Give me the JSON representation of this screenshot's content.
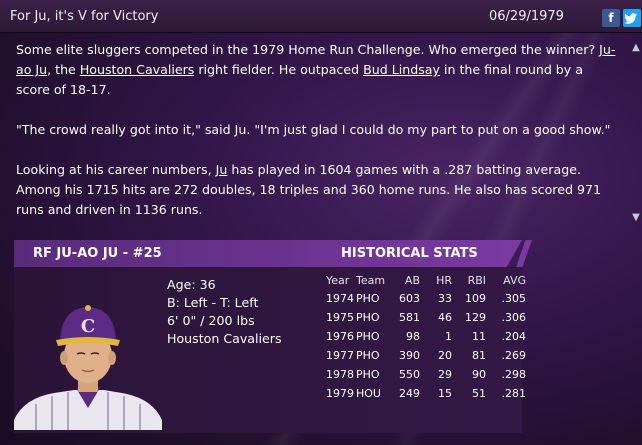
{
  "header": {
    "title": "For Ju, it's V for Victory",
    "date": "06/29/1979",
    "share_facebook": "f",
    "share_twitter": "t"
  },
  "article": {
    "p1_a": "Some elite sluggers competed in the 1979 Home Run Challenge. Who emerged the winner? ",
    "p1_link_player": "Ju-ao Ju",
    "p1_b": ", the ",
    "p1_link_team": "Houston Cavaliers",
    "p1_c": " right fielder. He outpaced ",
    "p1_link_opponent": "Bud Lindsay",
    "p1_d": " in the final round by a score of 18-17.",
    "p2": "\"The crowd really got into it,\" said Ju. \"I'm just glad I could do my part to put on a good show.\"",
    "p3_a": "Looking at his career numbers, ",
    "p3_link": "Ju",
    "p3_b": " has played in 1604 games with a .287 batting average. Among his 1715 hits are 272 doubles, 18 triples and 360 home runs. He also has scored 971 runs and driven in 1136 runs."
  },
  "player": {
    "header": "RF JU-AO JU - #25",
    "age": "Age: 36",
    "bats_throws": "B: Left - T: Left",
    "height_weight": "6' 0\" / 200 lbs",
    "team": "Houston Cavaliers"
  },
  "stats": {
    "title": "HISTORICAL STATS",
    "columns": [
      "Year",
      "Team",
      "AB",
      "HR",
      "RBI",
      "AVG"
    ],
    "rows": [
      [
        "1974",
        "PHO",
        "603",
        "33",
        "109",
        ".305"
      ],
      [
        "1975",
        "PHO",
        "581",
        "46",
        "129",
        ".306"
      ],
      [
        "1976",
        "PHO",
        "98",
        "1",
        "11",
        ".204"
      ],
      [
        "1977",
        "PHO",
        "390",
        "20",
        "81",
        ".269"
      ],
      [
        "1978",
        "PHO",
        "550",
        "29",
        "90",
        ".298"
      ],
      [
        "1979",
        "HOU",
        "249",
        "15",
        "51",
        ".281"
      ]
    ]
  },
  "colors": {
    "accent": "#7a3aa3",
    "background": "#2a1236"
  }
}
